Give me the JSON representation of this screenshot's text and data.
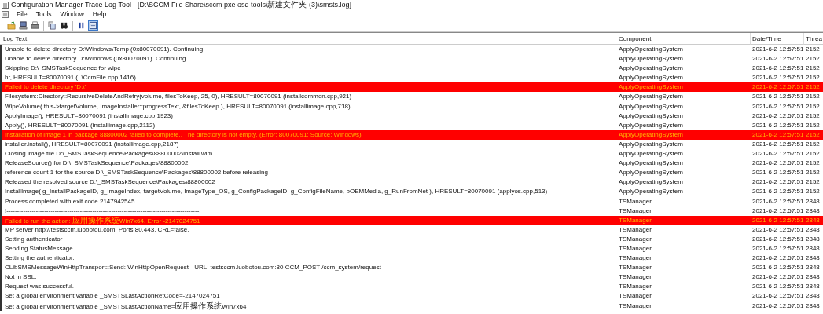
{
  "window": {
    "title": "Configuration Manager Trace Log Tool - [D:\\SCCM File Share\\sccm pxe osd tools\\新建文件夹 (3)\\smsts.log]"
  },
  "menu": [
    "File",
    "Tools",
    "Window",
    "Help"
  ],
  "toolbar": [
    {
      "kind": "open",
      "pressed": false
    },
    {
      "kind": "server",
      "pressed": false
    },
    {
      "kind": "print",
      "pressed": false
    },
    {
      "kind": "separator"
    },
    {
      "kind": "copy",
      "pressed": false
    },
    {
      "kind": "find",
      "pressed": false
    },
    {
      "kind": "separator"
    },
    {
      "kind": "pause",
      "pressed": false
    },
    {
      "kind": "highlight",
      "pressed": true
    }
  ],
  "table": {
    "columns": [
      "Log Text",
      "Component",
      "Date/Time",
      "Threa"
    ],
    "rows": [
      {
        "error": false,
        "cells": [
          "Unable to delete directory D:\\Windows\\Temp (0x80070091).  Continuing.",
          "ApplyOperatingSystem",
          "2021-6-2 12:57:51",
          "2152"
        ]
      },
      {
        "error": false,
        "cells": [
          "Unable to delete directory D:\\Windows (0x80070091).  Continuing.",
          "ApplyOperatingSystem",
          "2021-6-2 12:57:51",
          "2152"
        ]
      },
      {
        "error": false,
        "cells": [
          "Skipping D:\\_SMSTaskSequence for wipe",
          "ApplyOperatingSystem",
          "2021-6-2 12:57:51",
          "2152"
        ]
      },
      {
        "error": false,
        "cells": [
          "hr, HRESULT=80070091 (..\\CcmFile.cpp,1416)",
          "ApplyOperatingSystem",
          "2021-6-2 12:57:51",
          "2152"
        ]
      },
      {
        "error": true,
        "cells": [
          "Failed to delete directory 'D:\\'",
          "ApplyOperatingSystem",
          "2021-6-2 12:57:51",
          "2152"
        ]
      },
      {
        "error": false,
        "cells": [
          "Filesystem::Directory::RecursiveDeleteAndRetry(volume, filesToKeep, 25, 0), HRESULT=80070091 (installcommon.cpp,921)",
          "ApplyOperatingSystem",
          "2021-6-2 12:57:51",
          "2152"
        ]
      },
      {
        "error": false,
        "cells": [
          "WipeVolume( this->targetVolume, ImageInstaller::progressText, &filesToKeep ), HRESULT=80070091 (installimage.cpp,718)",
          "ApplyOperatingSystem",
          "2021-6-2 12:57:51",
          "2152"
        ]
      },
      {
        "error": false,
        "cells": [
          "ApplyImage(), HRESULT=80070091 (installimage.cpp,1923)",
          "ApplyOperatingSystem",
          "2021-6-2 12:57:51",
          "2152"
        ]
      },
      {
        "error": false,
        "cells": [
          "Apply(), HRESULT=80070091 (installimage.cpp,2112)",
          "ApplyOperatingSystem",
          "2021-6-2 12:57:51",
          "2152"
        ]
      },
      {
        "error": true,
        "cells": [
          "Installation of image 1 in package 88800002 failed to complete.. The directory is not empty. (Error: 80070091; Source: Windows)",
          "ApplyOperatingSystem",
          "2021-6-2 12:57:51",
          "2152"
        ]
      },
      {
        "error": false,
        "cells": [
          "installer.install(), HRESULT=80070091 (installimage.cpp,2187)",
          "ApplyOperatingSystem",
          "2021-6-2 12:57:51",
          "2152"
        ]
      },
      {
        "error": false,
        "cells": [
          "Closing image file D:\\_SMSTaskSequence\\Packages\\88800002\\install.wim",
          "ApplyOperatingSystem",
          "2021-6-2 12:57:51",
          "2152"
        ]
      },
      {
        "error": false,
        "cells": [
          "ReleaseSource() for D:\\_SMSTaskSequence\\Packages\\88800002.",
          "ApplyOperatingSystem",
          "2021-6-2 12:57:51",
          "2152"
        ]
      },
      {
        "error": false,
        "cells": [
          "reference count 1 for the source D:\\_SMSTaskSequence\\Packages\\88800002 before releasing",
          "ApplyOperatingSystem",
          "2021-6-2 12:57:51",
          "2152"
        ]
      },
      {
        "error": false,
        "cells": [
          "Released the resolved source D:\\_SMSTaskSequence\\Packages\\88800002",
          "ApplyOperatingSystem",
          "2021-6-2 12:57:51",
          "2152"
        ]
      },
      {
        "error": false,
        "cells": [
          "InstallImage( g_InstallPackageID, g_ImageIndex, targetVolume, ImageType_OS, g_ConfigPackageID, g_ConfigFileName, bOEMMedia, g_RunFromNet ), HRESULT=80070091 (applyos.cpp,513)",
          "ApplyOperatingSystem",
          "2021-6-2 12:57:51",
          "2152"
        ]
      },
      {
        "error": false,
        "cells": [
          "Process completed with exit code 2147942545",
          "TSManager",
          "2021-6-2 12:57:51",
          "2848"
        ]
      },
      {
        "error": false,
        "cells": [
          "!--------------------------------------------------------------------------------------------!",
          "TSManager",
          "2021-6-2 12:57:51",
          "2848"
        ]
      },
      {
        "error": true,
        "cells": [
          "Failed to run the action: 应用操作系统Win7x64. Error -2147024751",
          "TSManager",
          "2021-6-2 12:57:51",
          "2848"
        ]
      },
      {
        "error": false,
        "cells": [
          "MP server http://testsccm.luobotou.com. Ports 80,443. CRL=false.",
          "TSManager",
          "2021-6-2 12:57:51",
          "2848"
        ]
      },
      {
        "error": false,
        "cells": [
          "Setting authenticator",
          "TSManager",
          "2021-6-2 12:57:51",
          "2848"
        ]
      },
      {
        "error": false,
        "cells": [
          "Sending StatusMessage",
          "TSManager",
          "2021-6-2 12:57:51",
          "2848"
        ]
      },
      {
        "error": false,
        "cells": [
          "Setting the authenticator.",
          "TSManager",
          "2021-6-2 12:57:51",
          "2848"
        ]
      },
      {
        "error": false,
        "cells": [
          "CLibSMSMessageWinHttpTransport::Send: WinHttpOpenRequest - URL: testsccm.luobotou.com:80  CCM_POST /ccm_system/request",
          "TSManager",
          "2021-6-2 12:57:51",
          "2848"
        ]
      },
      {
        "error": false,
        "cells": [
          "Not in SSL.",
          "TSManager",
          "2021-6-2 12:57:51",
          "2848"
        ]
      },
      {
        "error": false,
        "cells": [
          "Request was successful.",
          "TSManager",
          "2021-6-2 12:57:51",
          "2848"
        ]
      },
      {
        "error": false,
        "cells": [
          "Set a global environment variable _SMSTSLastActionRetCode=-2147024751",
          "TSManager",
          "2021-6-2 12:57:51",
          "2848"
        ]
      },
      {
        "error": false,
        "cells": [
          "Set a global environment variable _SMSTSLastActionName=应用操作系统Win7x64",
          "TSManager",
          "2021-6-2 12:57:51",
          "2848"
        ]
      }
    ]
  }
}
